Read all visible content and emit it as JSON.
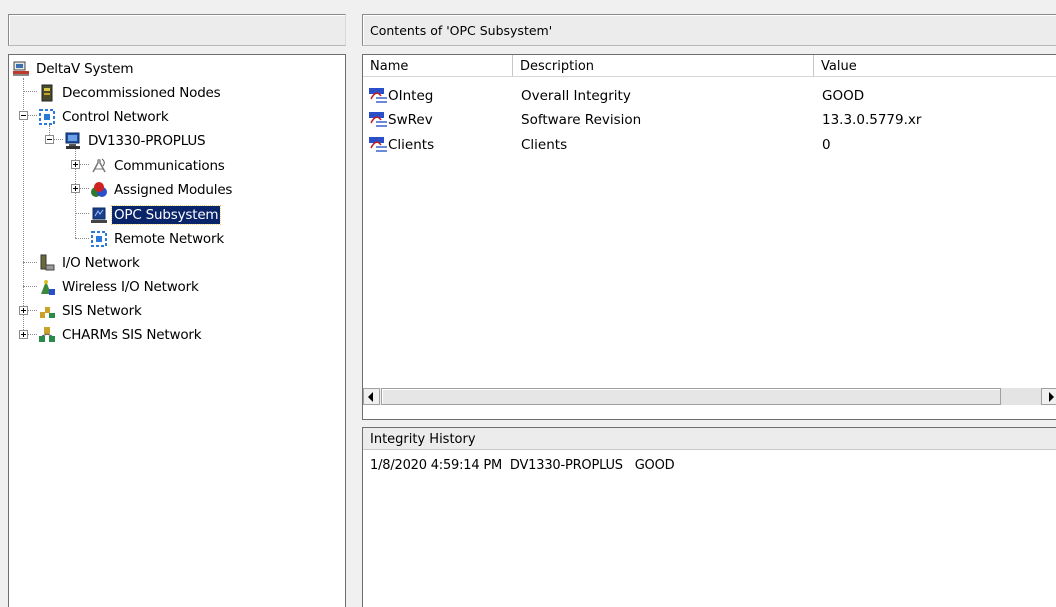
{
  "left_header": {
    "title": ""
  },
  "right_header": {
    "title": "Contents of 'OPC Subsystem'"
  },
  "tree": {
    "items": [
      {
        "label": "DeltaV System",
        "icon": "deltav-system-icon"
      },
      {
        "label": "Decommissioned Nodes",
        "icon": "decommissioned-nodes-icon"
      },
      {
        "label": "Control Network",
        "icon": "control-network-icon"
      },
      {
        "label": "DV1330-PROPLUS",
        "icon": "proplus-workstation-icon"
      },
      {
        "label": "Communications",
        "icon": "communications-icon"
      },
      {
        "label": "Assigned Modules",
        "icon": "assigned-modules-icon"
      },
      {
        "label": "OPC Subsystem",
        "icon": "opc-subsystem-icon",
        "selected": true
      },
      {
        "label": "Remote Network",
        "icon": "remote-network-icon"
      },
      {
        "label": "I/O Network",
        "icon": "io-network-icon"
      },
      {
        "label": "Wireless I/O Network",
        "icon": "wireless-io-network-icon"
      },
      {
        "label": "SIS Network",
        "icon": "sis-network-icon"
      },
      {
        "label": "CHARMs SIS Network",
        "icon": "charms-sis-network-icon"
      }
    ]
  },
  "list": {
    "columns": [
      "Name",
      "Description",
      "Value"
    ],
    "rows": [
      {
        "name": "OInteg",
        "description": "Overall Integrity",
        "value": "GOOD",
        "icon": "parameter-icon"
      },
      {
        "name": "SwRev",
        "description": "Software Revision",
        "value": "13.3.0.5779.xr",
        "icon": "parameter-icon"
      },
      {
        "name": "Clients",
        "description": "Clients",
        "value": "0",
        "icon": "parameter-icon"
      }
    ]
  },
  "history": {
    "title": "Integrity History",
    "entries": [
      {
        "timestamp": "1/8/2020 4:59:14 PM",
        "node": "DV1330-PROPLUS",
        "status": "GOOD"
      }
    ]
  },
  "colors": {
    "selection": "#0a246a",
    "window_bg": "#f0f0f0"
  }
}
